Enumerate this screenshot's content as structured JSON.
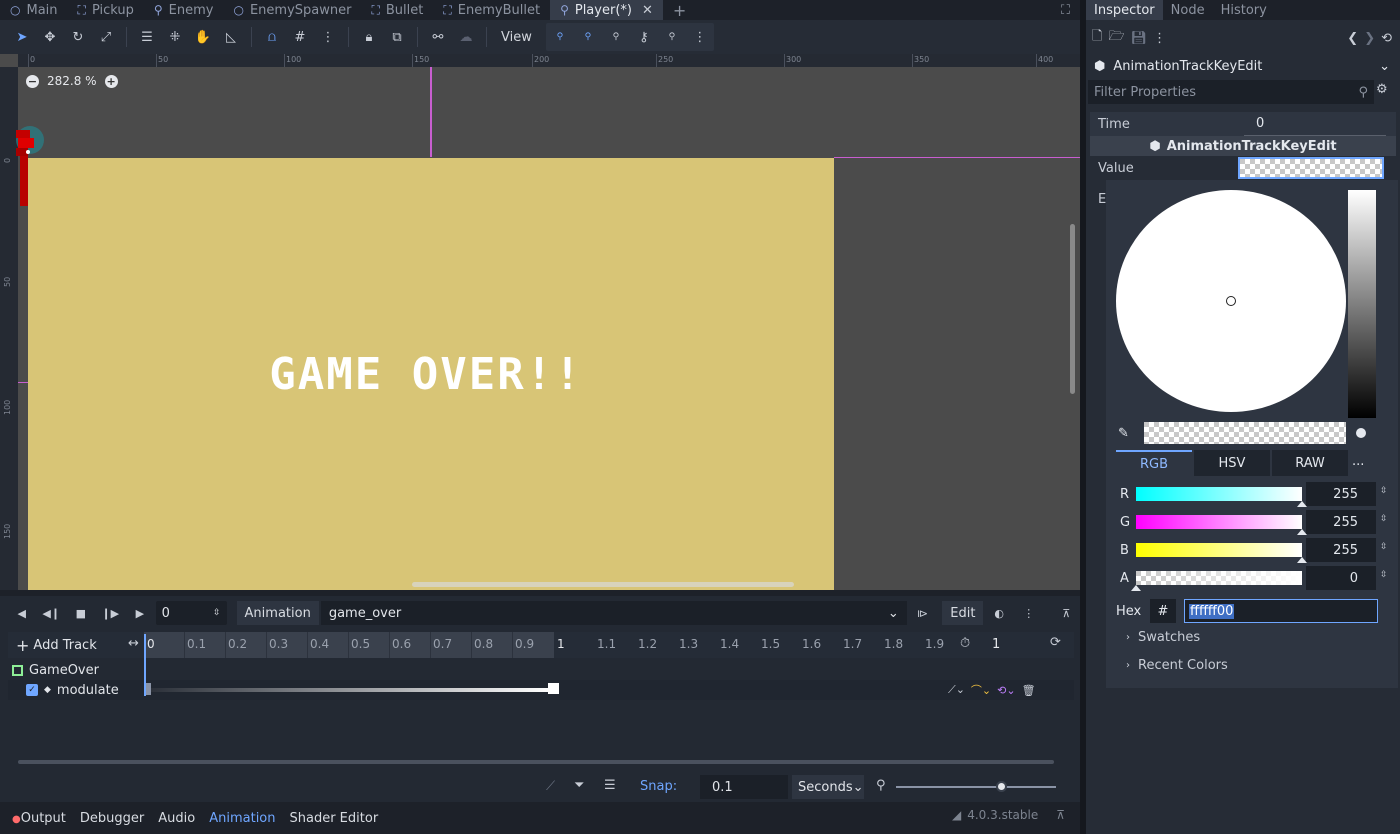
{
  "scene_tabs": [
    {
      "label": "Main",
      "icon": "circle-node-icon",
      "active": false
    },
    {
      "label": "Pickup",
      "icon": "area-node-icon",
      "active": false
    },
    {
      "label": "Enemy",
      "icon": "character-node-icon",
      "active": false
    },
    {
      "label": "EnemySpawner",
      "icon": "circle-node-icon",
      "active": false
    },
    {
      "label": "Bullet",
      "icon": "area-node-icon",
      "active": false
    },
    {
      "label": "EnemyBullet",
      "icon": "area-node-icon",
      "active": false
    },
    {
      "label": "Player(*)",
      "icon": "character-node-icon",
      "active": true
    }
  ],
  "toolbar": {
    "view_label": "View"
  },
  "viewport": {
    "zoom": "282.8 %",
    "game_text": "GAME OVER!!",
    "ruler_top": [
      "0",
      "50",
      "100",
      "150",
      "200",
      "250",
      "300",
      "350",
      "400"
    ],
    "ruler_left": [
      "0",
      "50",
      "100",
      "150"
    ],
    "game_bg_color": "#d8c576"
  },
  "animation": {
    "time_value": "0",
    "animation_label": "Animation",
    "animation_name": "game_over",
    "edit_label": "Edit",
    "add_track_label": "Add Track",
    "ticks": [
      "0",
      "0.1",
      "0.2",
      "0.3",
      "0.4",
      "0.5",
      "0.6",
      "0.7",
      "0.8",
      "0.9",
      "1",
      "1.1",
      "1.2",
      "1.3",
      "1.4",
      "1.5",
      "1.6",
      "1.7",
      "1.8",
      "1.9"
    ],
    "length_value": "1",
    "tracks": {
      "node": "GameOver",
      "property": "modulate"
    },
    "snap_label": "Snap:",
    "snap_value": "0.1",
    "snap_unit": "Seconds"
  },
  "bottom_tabs": [
    "Output",
    "Debugger",
    "Audio",
    "Animation",
    "Shader Editor"
  ],
  "version": "4.0.3.stable",
  "inspector": {
    "tabs": [
      "Inspector",
      "Node",
      "History"
    ],
    "resource": "AnimationTrackKeyEdit",
    "filter_placeholder": "Filter Properties",
    "time_label": "Time",
    "time_value": "0",
    "section": "AnimationTrackKeyEdit",
    "value_label": "Value",
    "hidden_row_letter": "E"
  },
  "color_picker": {
    "modes": [
      "RGB",
      "HSV",
      "RAW"
    ],
    "more": "...",
    "channels": [
      {
        "name": "R",
        "value": "255"
      },
      {
        "name": "G",
        "value": "255"
      },
      {
        "name": "B",
        "value": "255"
      },
      {
        "name": "A",
        "value": "0"
      }
    ],
    "hex_label": "Hex",
    "hash": "#",
    "hex_value": "ffffff00",
    "swatches_label": "Swatches",
    "recent_label": "Recent Colors"
  }
}
